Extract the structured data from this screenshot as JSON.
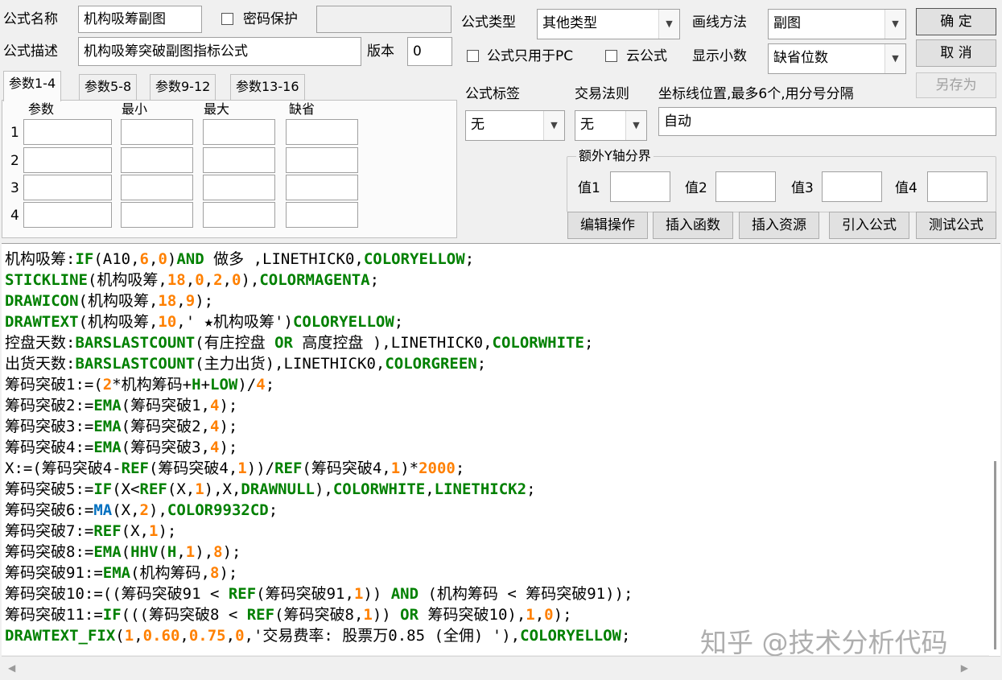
{
  "colors": {
    "keyword": "#008000",
    "number": "#ff8000",
    "text": "#000000",
    "function_blue": "#0070c0"
  },
  "formula_name": {
    "label": "公式名称",
    "value": "机构吸筹副图"
  },
  "password": {
    "label": "密码保护",
    "checked": false,
    "value": ""
  },
  "formula_desc": {
    "label": "公式描述",
    "value": "机构吸筹突破副图指标公式"
  },
  "version": {
    "label": "版本",
    "value": "0"
  },
  "formula_type": {
    "label": "公式类型",
    "value": "其他类型"
  },
  "draw_method": {
    "label": "画线方法",
    "value": "副图"
  },
  "pc_only": {
    "label": "公式只用于PC",
    "checked": false
  },
  "cloud": {
    "label": "云公式",
    "checked": false
  },
  "decimals": {
    "label": "显示小数",
    "value": "缺省位数"
  },
  "buttons": {
    "ok": "确 定",
    "cancel": "取 消",
    "save_as": "另存为"
  },
  "tabs": [
    "参数1-4",
    "参数5-8",
    "参数9-12",
    "参数13-16"
  ],
  "param_headers": [
    "参数",
    "最小",
    "最大",
    "缺省"
  ],
  "param_rows": [
    "1",
    "2",
    "3",
    "4"
  ],
  "formula_tag": {
    "label": "公式标签",
    "value": "无"
  },
  "trade_rule": {
    "label": "交易法则",
    "value": "无"
  },
  "coord_lines": {
    "label": "坐标线位置,最多6个,用分号分隔",
    "value": "自动"
  },
  "extra_y": {
    "title": "额外Y轴分界",
    "labels": [
      "值1",
      "值2",
      "值3",
      "值4"
    ]
  },
  "actions": [
    "编辑操作",
    "插入函数",
    "插入资源",
    "引入公式",
    "测试公式"
  ],
  "code_lines": [
    [
      [
        "机构吸筹:",
        "t"
      ],
      [
        "IF",
        "k"
      ],
      [
        "(A10,",
        "t"
      ],
      [
        "6",
        "n"
      ],
      [
        ",",
        "t"
      ],
      [
        "0",
        "n"
      ],
      [
        ")",
        "t"
      ],
      [
        "AND",
        "k"
      ],
      [
        " 做多 ,LINETHICK0,",
        "t"
      ],
      [
        "COLORYELLOW",
        "k"
      ],
      [
        ";",
        "t"
      ]
    ],
    [
      [
        "STICKLINE",
        "k"
      ],
      [
        "(机构吸筹,",
        "t"
      ],
      [
        "18",
        "n"
      ],
      [
        ",",
        "t"
      ],
      [
        "0",
        "n"
      ],
      [
        ",",
        "t"
      ],
      [
        "2",
        "n"
      ],
      [
        ",",
        "t"
      ],
      [
        "0",
        "n"
      ],
      [
        "),",
        "t"
      ],
      [
        "COLORMAGENTA",
        "k"
      ],
      [
        ";",
        "t"
      ]
    ],
    [
      [
        "DRAWICON",
        "k"
      ],
      [
        "(机构吸筹,",
        "t"
      ],
      [
        "18",
        "n"
      ],
      [
        ",",
        "t"
      ],
      [
        "9",
        "n"
      ],
      [
        ");",
        "t"
      ]
    ],
    [
      [
        "DRAWTEXT",
        "k"
      ],
      [
        "(机构吸筹,",
        "t"
      ],
      [
        "10",
        "n"
      ],
      [
        ",' ★机构吸筹')",
        "t"
      ],
      [
        "COLORYELLOW",
        "k"
      ],
      [
        ";",
        "t"
      ]
    ],
    [
      [
        "控盘天数:",
        "t"
      ],
      [
        "BARSLASTCOUNT",
        "k"
      ],
      [
        "(有庄控盘 ",
        "t"
      ],
      [
        "OR",
        "k"
      ],
      [
        " 高度控盘 ),LINETHICK0,",
        "t"
      ],
      [
        "COLORWHITE",
        "k"
      ],
      [
        ";",
        "t"
      ]
    ],
    [
      [
        "出货天数:",
        "t"
      ],
      [
        "BARSLASTCOUNT",
        "k"
      ],
      [
        "(主力出货),LINETHICK0,",
        "t"
      ],
      [
        "COLORGREEN",
        "k"
      ],
      [
        ";",
        "t"
      ]
    ],
    [
      [
        "筹码突破1:=(",
        "t"
      ],
      [
        "2",
        "n"
      ],
      [
        "*机构筹码+",
        "t"
      ],
      [
        "H",
        "k"
      ],
      [
        "+",
        "t"
      ],
      [
        "LOW",
        "k"
      ],
      [
        ")/",
        "t"
      ],
      [
        "4",
        "n"
      ],
      [
        ";",
        "t"
      ]
    ],
    [
      [
        "筹码突破2:=",
        "t"
      ],
      [
        "EMA",
        "k"
      ],
      [
        "(筹码突破1,",
        "t"
      ],
      [
        "4",
        "n"
      ],
      [
        ");",
        "t"
      ]
    ],
    [
      [
        "筹码突破3:=",
        "t"
      ],
      [
        "EMA",
        "k"
      ],
      [
        "(筹码突破2,",
        "t"
      ],
      [
        "4",
        "n"
      ],
      [
        ");",
        "t"
      ]
    ],
    [
      [
        "筹码突破4:=",
        "t"
      ],
      [
        "EMA",
        "k"
      ],
      [
        "(筹码突破3,",
        "t"
      ],
      [
        "4",
        "n"
      ],
      [
        ");",
        "t"
      ]
    ],
    [
      [
        "X:=(筹码突破4-",
        "t"
      ],
      [
        "REF",
        "k"
      ],
      [
        "(筹码突破4,",
        "t"
      ],
      [
        "1",
        "n"
      ],
      [
        "))/",
        "t"
      ],
      [
        "REF",
        "k"
      ],
      [
        "(筹码突破4,",
        "t"
      ],
      [
        "1",
        "n"
      ],
      [
        ")*",
        "t"
      ],
      [
        "2000",
        "n"
      ],
      [
        ";",
        "t"
      ]
    ],
    [
      [
        "筹码突破5:=",
        "t"
      ],
      [
        "IF",
        "k"
      ],
      [
        "(X<",
        "t"
      ],
      [
        "REF",
        "k"
      ],
      [
        "(X,",
        "t"
      ],
      [
        "1",
        "n"
      ],
      [
        "),X,",
        "t"
      ],
      [
        "DRAWNULL",
        "k"
      ],
      [
        "),",
        "t"
      ],
      [
        "COLORWHITE",
        "k"
      ],
      [
        ",",
        "t"
      ],
      [
        "LINETHICK2",
        "k"
      ],
      [
        ";",
        "t"
      ]
    ],
    [
      [
        "筹码突破6:=",
        "t"
      ],
      [
        "MA",
        "b"
      ],
      [
        "(X,",
        "t"
      ],
      [
        "2",
        "n"
      ],
      [
        "),",
        "t"
      ],
      [
        "COLOR9932CD",
        "k"
      ],
      [
        ";",
        "t"
      ]
    ],
    [
      [
        "筹码突破7:=",
        "t"
      ],
      [
        "REF",
        "k"
      ],
      [
        "(X,",
        "t"
      ],
      [
        "1",
        "n"
      ],
      [
        ");",
        "t"
      ]
    ],
    [
      [
        "筹码突破8:=",
        "t"
      ],
      [
        "EMA",
        "k"
      ],
      [
        "(",
        "t"
      ],
      [
        "HHV",
        "k"
      ],
      [
        "(",
        "t"
      ],
      [
        "H",
        "k"
      ],
      [
        ",",
        "t"
      ],
      [
        "1",
        "n"
      ],
      [
        "),",
        "t"
      ],
      [
        "8",
        "n"
      ],
      [
        ");",
        "t"
      ]
    ],
    [
      [
        "筹码突破91:=",
        "t"
      ],
      [
        "EMA",
        "k"
      ],
      [
        "(机构筹码,",
        "t"
      ],
      [
        "8",
        "n"
      ],
      [
        ");",
        "t"
      ]
    ],
    [
      [
        "筹码突破10:=((筹码突破91 < ",
        "t"
      ],
      [
        "REF",
        "k"
      ],
      [
        "(筹码突破91,",
        "t"
      ],
      [
        "1",
        "n"
      ],
      [
        ")) ",
        "t"
      ],
      [
        "AND",
        "k"
      ],
      [
        " (机构筹码 < 筹码突破91));",
        "t"
      ]
    ],
    [
      [
        "筹码突破11:=",
        "t"
      ],
      [
        "IF",
        "k"
      ],
      [
        "(((筹码突破8 < ",
        "t"
      ],
      [
        "REF",
        "k"
      ],
      [
        "(筹码突破8,",
        "t"
      ],
      [
        "1",
        "n"
      ],
      [
        ")) ",
        "t"
      ],
      [
        "OR",
        "k"
      ],
      [
        " 筹码突破10),",
        "t"
      ],
      [
        "1",
        "n"
      ],
      [
        ",",
        "t"
      ],
      [
        "0",
        "n"
      ],
      [
        ");",
        "t"
      ]
    ],
    [
      [
        "DRAWTEXT_FIX",
        "k"
      ],
      [
        "(",
        "t"
      ],
      [
        "1",
        "n"
      ],
      [
        ",",
        "t"
      ],
      [
        "0.60",
        "n"
      ],
      [
        ",",
        "t"
      ],
      [
        "0.75",
        "n"
      ],
      [
        ",",
        "t"
      ],
      [
        "0",
        "n"
      ],
      [
        ",'交易费率: 股票万0.85 (全佣) '),",
        "t"
      ],
      [
        "COLORYELLOW",
        "k"
      ],
      [
        ";",
        "t"
      ]
    ]
  ],
  "watermark": "知乎 @技术分析代码"
}
